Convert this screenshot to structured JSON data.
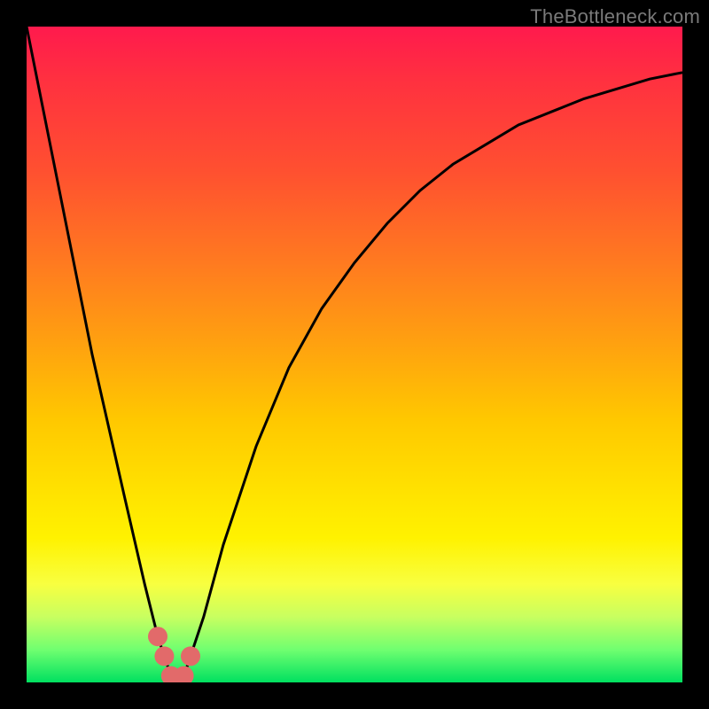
{
  "watermark": {
    "text": "TheBottleneck.com"
  },
  "colors": {
    "background": "#000000",
    "curve": "#000000",
    "marker": "#e26a6a",
    "gradient_top": "#ff1a4d",
    "gradient_bottom": "#00e060"
  },
  "chart_data": {
    "type": "line",
    "title": "",
    "xlabel": "",
    "ylabel": "",
    "xlim": [
      0,
      100
    ],
    "ylim": [
      0,
      100
    ],
    "grid": false,
    "legend": false,
    "series": [
      {
        "name": "bottleneck-curve",
        "x": [
          0,
          5,
          10,
          15,
          18,
          20,
          21,
          22,
          23,
          24,
          25,
          27,
          30,
          35,
          40,
          45,
          50,
          55,
          60,
          65,
          70,
          75,
          80,
          85,
          90,
          95,
          100
        ],
        "values": [
          100,
          75,
          50,
          28,
          15,
          7,
          4,
          1,
          0,
          1,
          4,
          10,
          21,
          36,
          48,
          57,
          64,
          70,
          75,
          79,
          82,
          85,
          87,
          89,
          90.5,
          92,
          93
        ]
      }
    ],
    "markers": {
      "name": "highlight-range",
      "x": [
        20,
        21,
        22,
        23,
        24,
        25
      ],
      "values": [
        7,
        4,
        1,
        0,
        1,
        4
      ]
    }
  }
}
